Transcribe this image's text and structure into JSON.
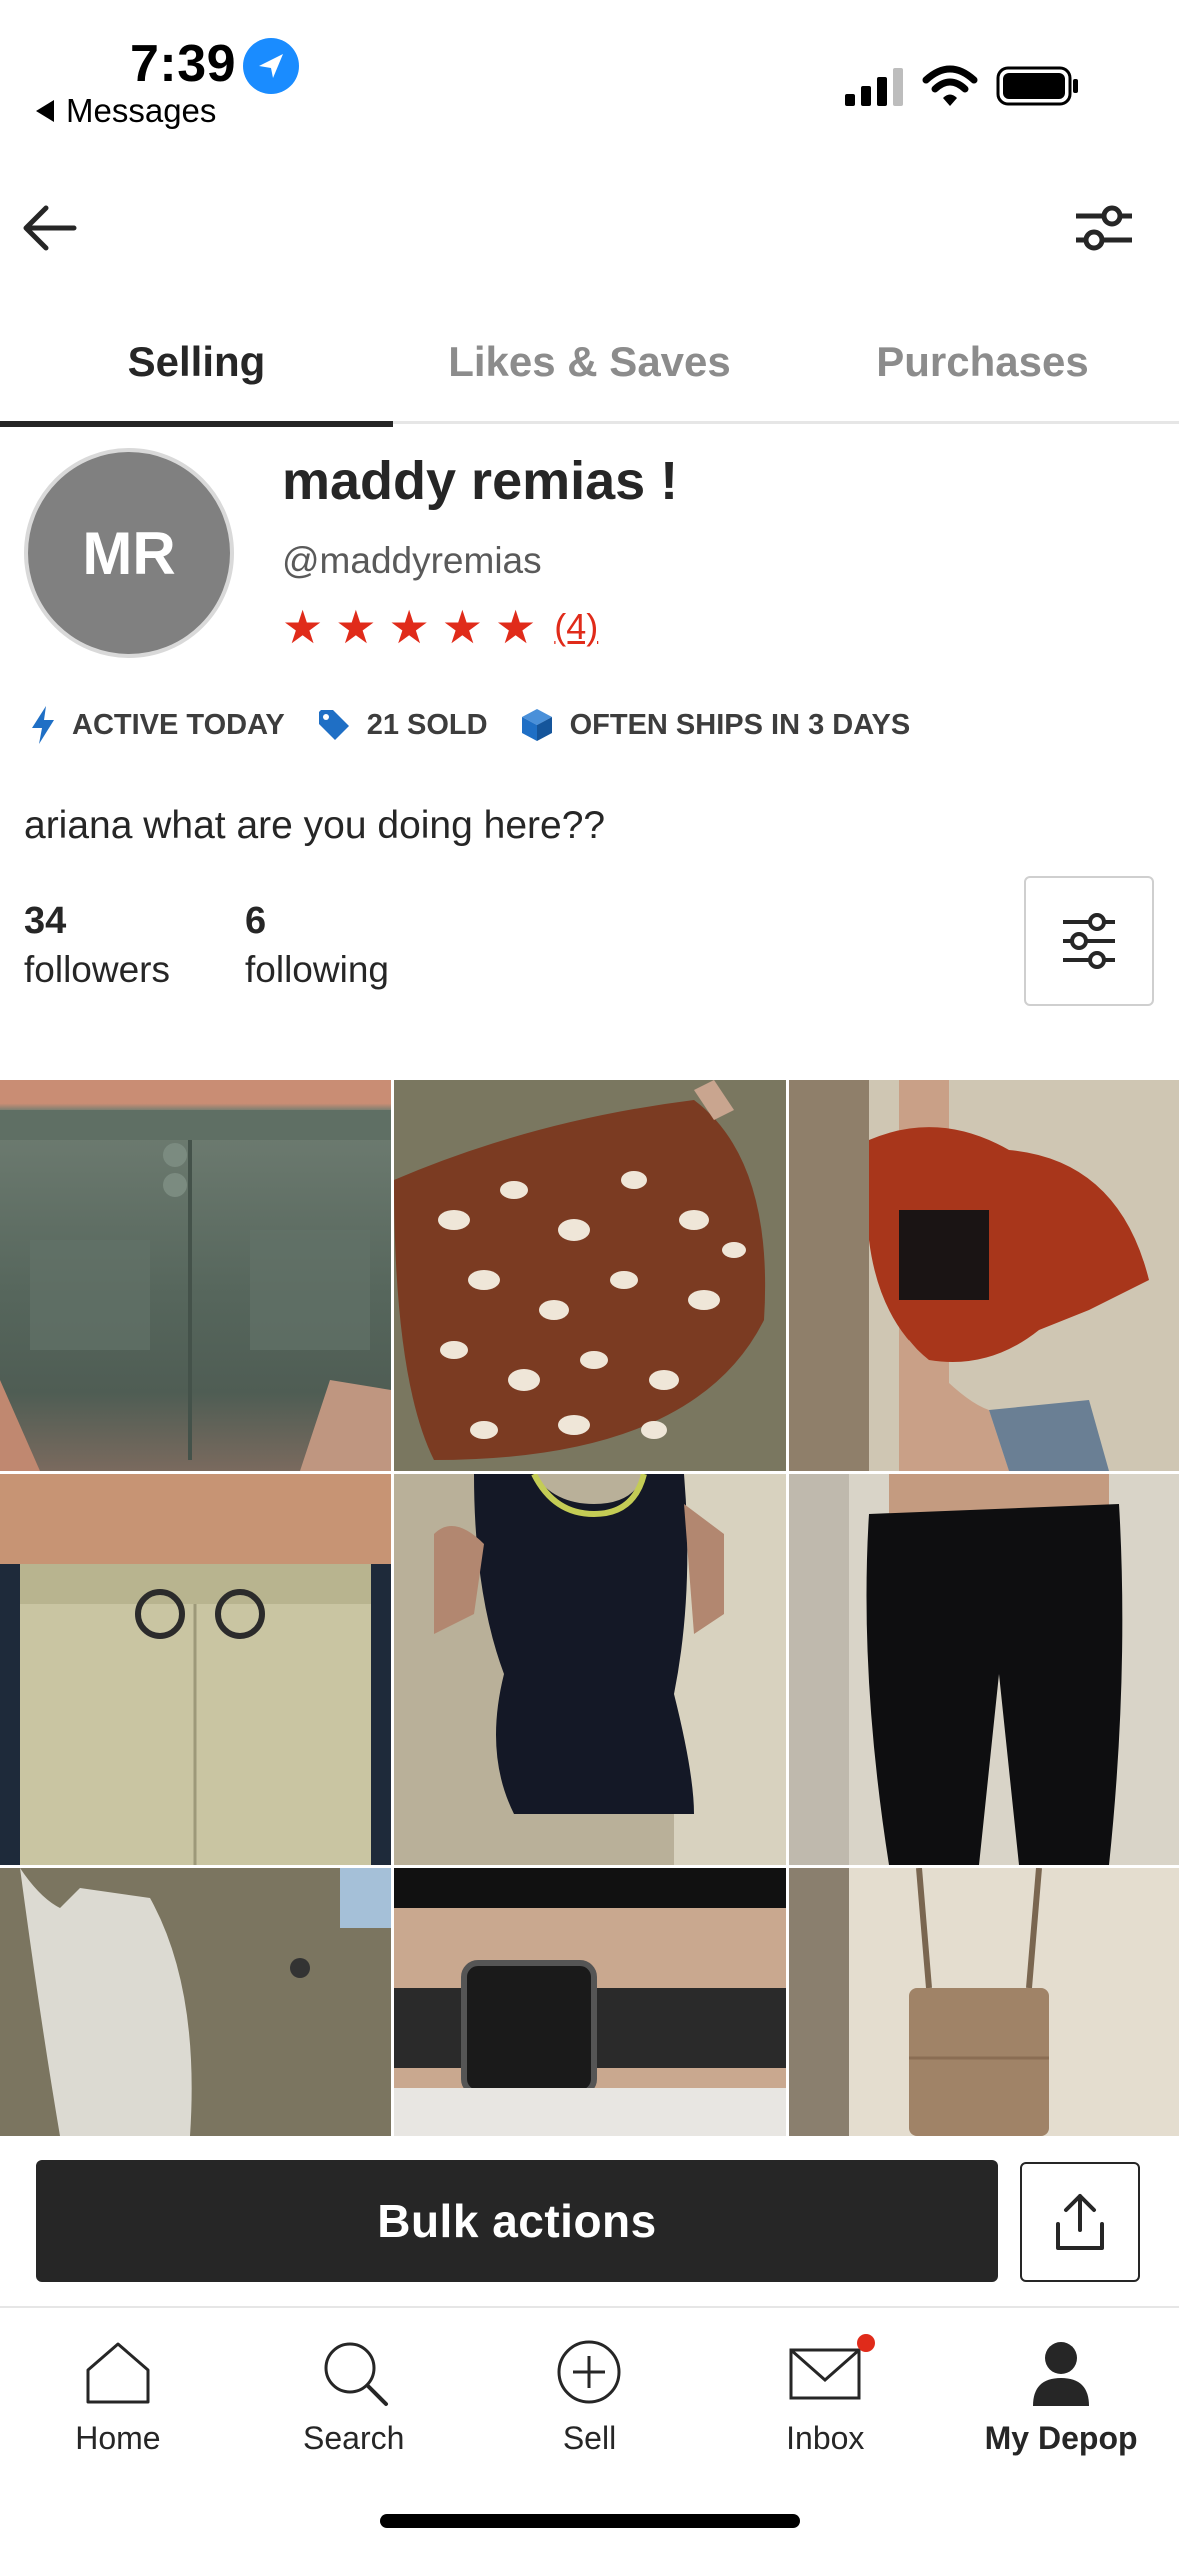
{
  "status_bar": {
    "time": "7:39",
    "back_app": "Messages"
  },
  "tabs": [
    {
      "label": "Selling",
      "active": true
    },
    {
      "label": "Likes & Saves",
      "active": false
    },
    {
      "label": "Purchases",
      "active": false
    }
  ],
  "profile": {
    "initials": "MR",
    "name": "maddy remias !",
    "handle": "@maddyremias",
    "rating_stars": 5,
    "review_count": "(4)",
    "bio": "ariana what are you doing here??"
  },
  "badges": [
    {
      "icon": "lightning-icon",
      "label": "ACTIVE TODAY"
    },
    {
      "icon": "tag-icon",
      "label": "21 SOLD"
    },
    {
      "icon": "box-icon",
      "label": "OFTEN SHIPS IN 3 DAYS"
    }
  ],
  "stats": {
    "followers_count": "34",
    "followers_label": "followers",
    "following_count": "6",
    "following_label": "following"
  },
  "listings": [
    {
      "name": "green cargo shorts"
    },
    {
      "name": "leopard ruffle skirt"
    },
    {
      "name": "rust satin tie top"
    },
    {
      "name": "cream buckle skirt"
    },
    {
      "name": "black bodysuit"
    },
    {
      "name": "black flare pants"
    },
    {
      "name": "white pants"
    },
    {
      "name": "snakeskin belt"
    },
    {
      "name": "tan crossbody bag"
    }
  ],
  "actions": {
    "bulk_label": "Bulk actions"
  },
  "nav": [
    {
      "icon": "home-icon",
      "label": "Home"
    },
    {
      "icon": "search-icon",
      "label": "Search"
    },
    {
      "icon": "plus-circle-icon",
      "label": "Sell"
    },
    {
      "icon": "mail-icon",
      "label": "Inbox"
    },
    {
      "icon": "person-icon",
      "label": "My Depop"
    }
  ],
  "colors": {
    "accent_red": "#e02b1a",
    "badge_blue": "#1f6fc5",
    "dark": "#262626"
  }
}
